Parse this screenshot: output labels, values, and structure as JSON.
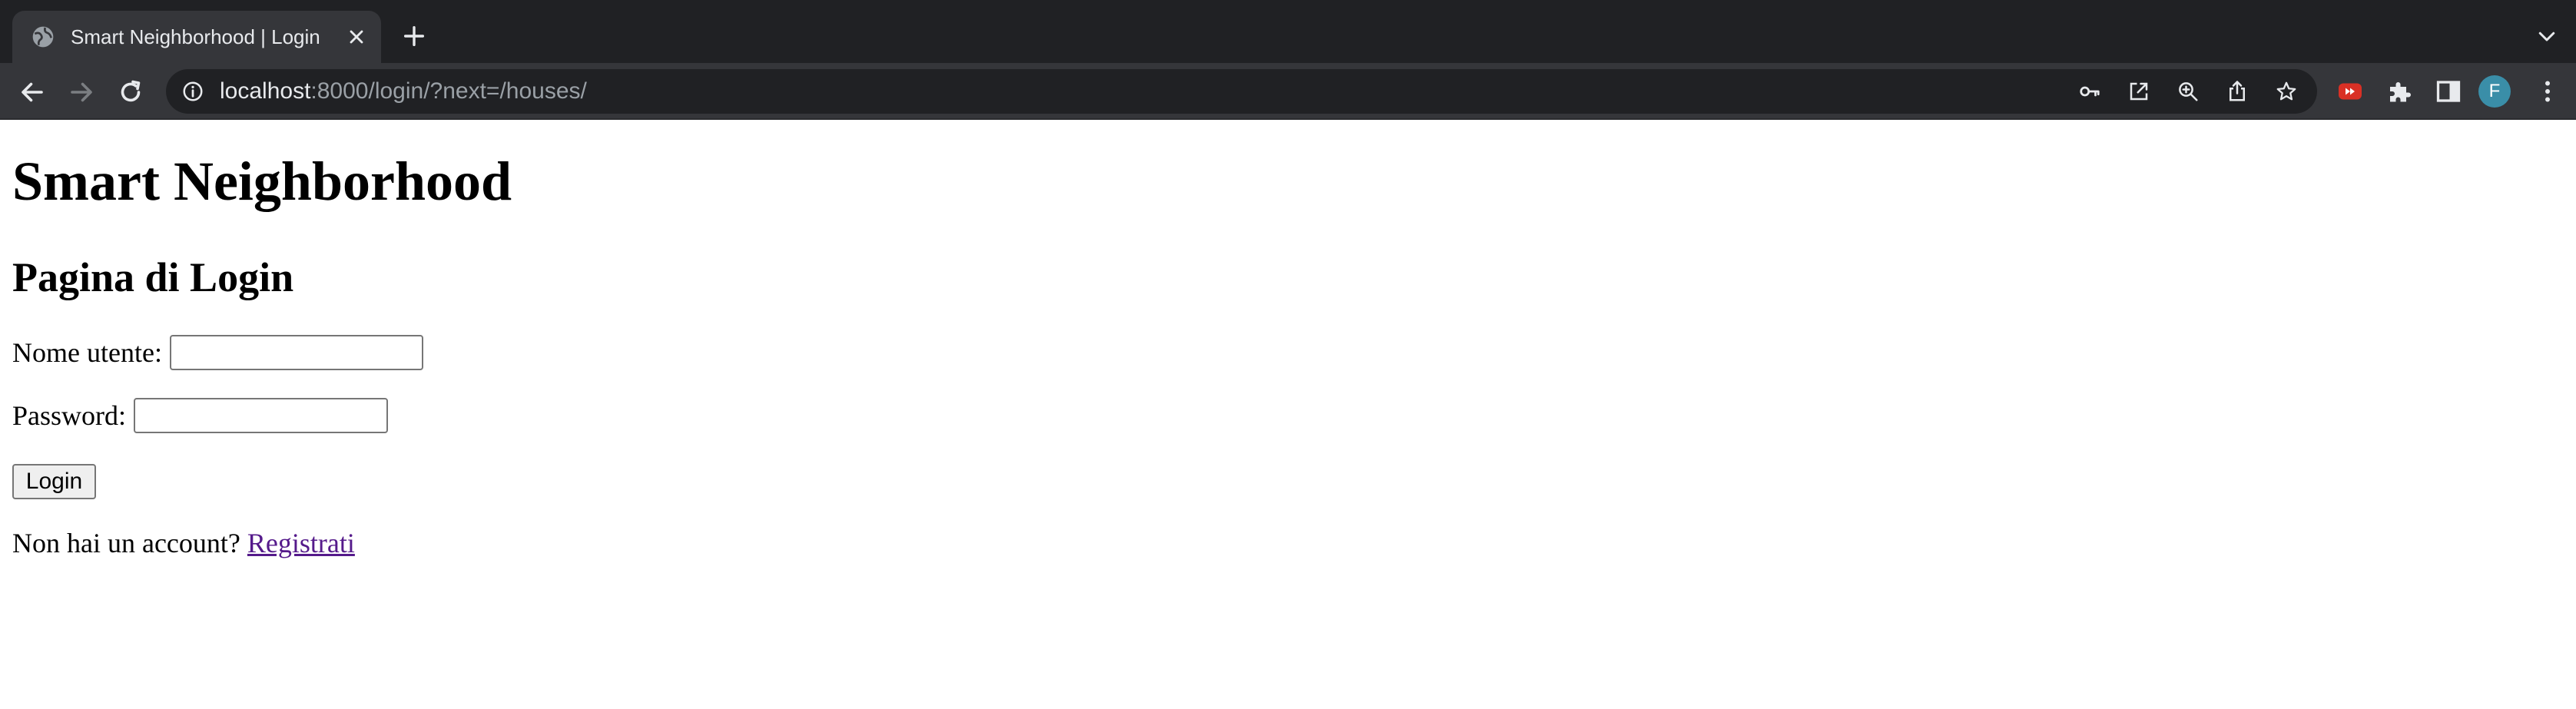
{
  "browser": {
    "tab_title": "Smart Neighborhood | Login",
    "url_host": "localhost",
    "url_rest": ":8000/login/?next=/houses/",
    "avatar_letter": "F",
    "colors": {
      "frame": "#202124",
      "toolbar": "#35363a",
      "avatar": "#3a8ea8",
      "extension_red": "#d93025"
    },
    "icons": [
      "globe-icon",
      "close-icon",
      "plus-icon",
      "chevron-down-icon",
      "back-arrow-icon",
      "forward-arrow-icon",
      "reload-icon",
      "info-icon",
      "key-icon",
      "open-in-app-icon",
      "zoom-icon",
      "share-icon",
      "star-icon",
      "extension-icon",
      "puzzle-icon",
      "side-panel-icon",
      "kebab-menu-icon"
    ]
  },
  "page": {
    "site_title": "Smart Neighborhood",
    "heading": "Pagina di Login",
    "username_label": "Nome utente:",
    "username_value": "",
    "password_label": "Password:",
    "password_value": "",
    "login_button": "Login",
    "register_prompt": "Non hai un account?",
    "register_link": "Registrati",
    "link_color": "#551a8b"
  }
}
